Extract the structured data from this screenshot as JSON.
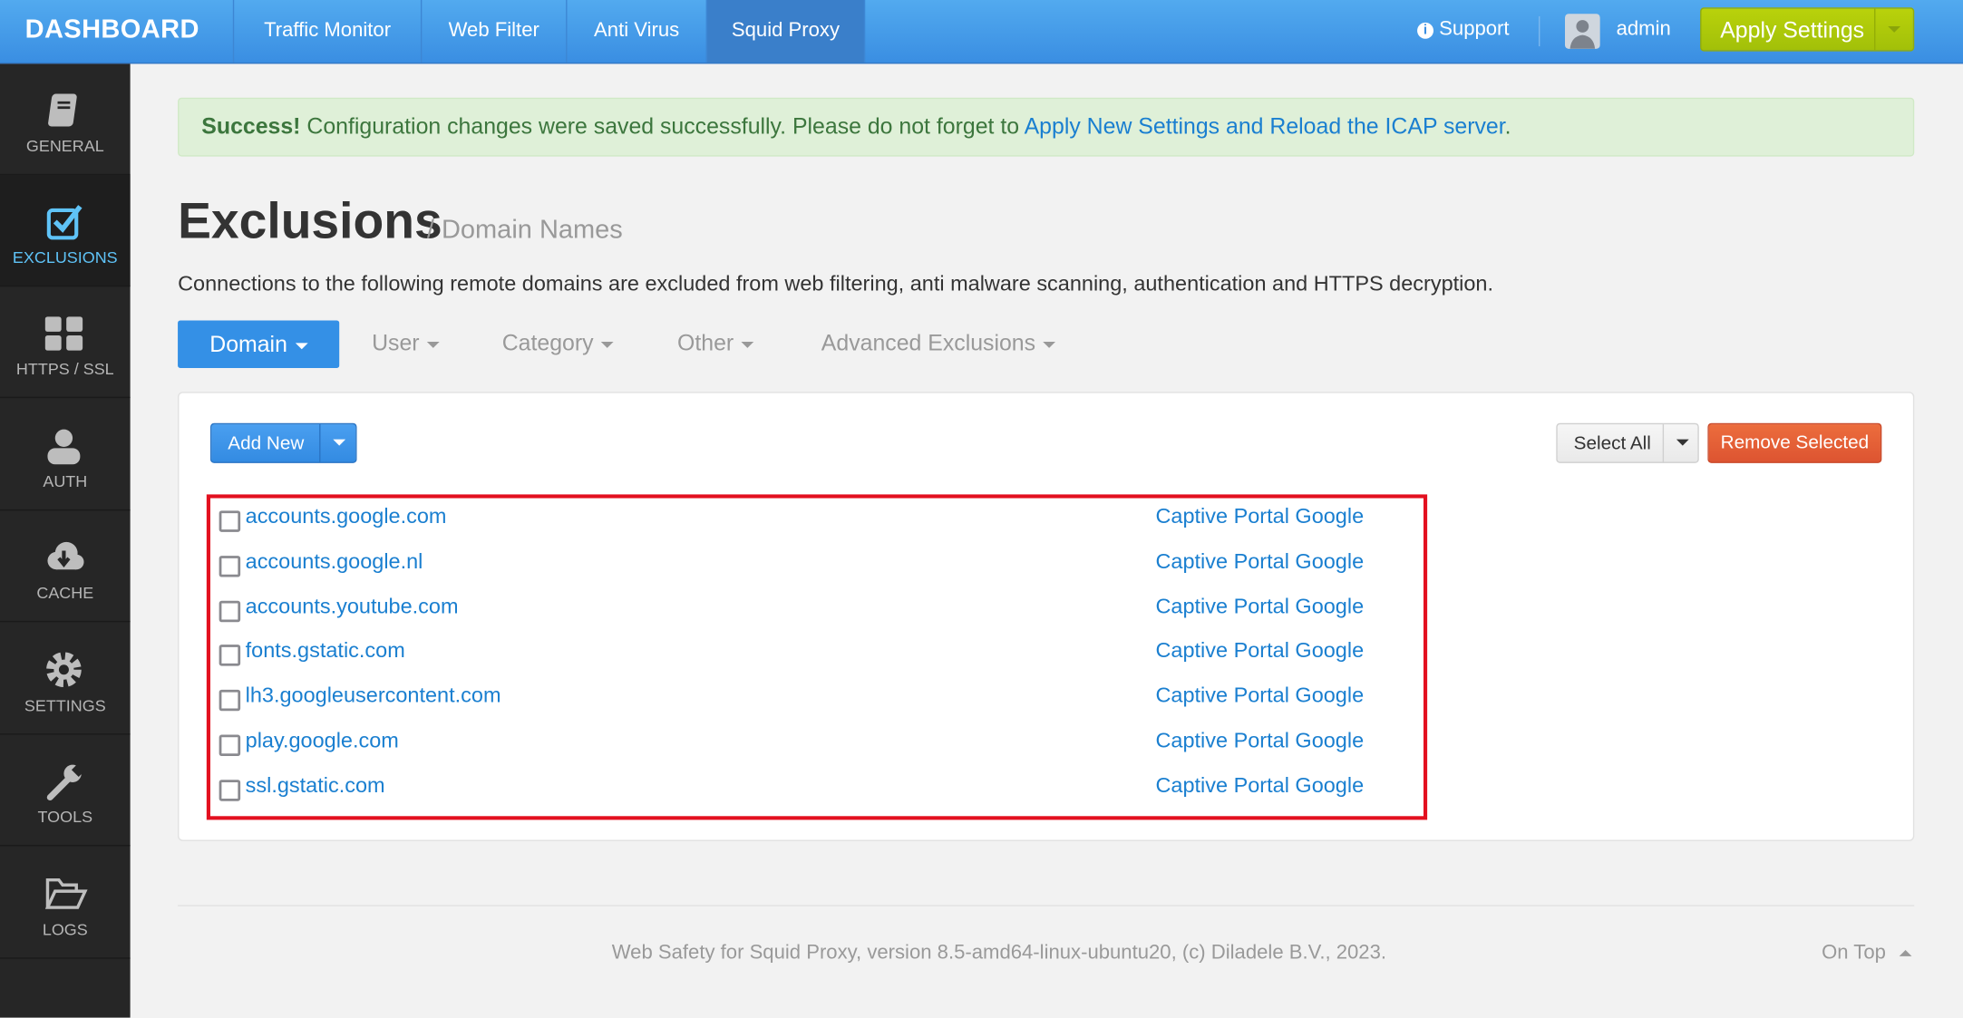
{
  "header": {
    "brand": "DASHBOARD",
    "nav": [
      "Traffic Monitor",
      "Web Filter",
      "Anti Virus",
      "Squid Proxy"
    ],
    "active_nav": "Squid Proxy",
    "support": "Support",
    "user": "admin",
    "apply": "Apply Settings"
  },
  "sidebar": {
    "items": [
      "GENERAL",
      "EXCLUSIONS",
      "HTTPS / SSL",
      "AUTH",
      "CACHE",
      "SETTINGS",
      "TOOLS",
      "LOGS"
    ],
    "active": "EXCLUSIONS"
  },
  "alert": {
    "strong": "Success!",
    "text": " Configuration changes were saved successfully. Please do not forget to ",
    "link": "Apply New Settings and Reload the ICAP server",
    "end": "."
  },
  "page": {
    "title": "Exclusions",
    "subtitle": "/ Domain Names",
    "description": "Connections to the following remote domains are excluded from web filtering, anti malware scanning, authentication and HTTPS decryption."
  },
  "tabs": [
    "Domain",
    "User",
    "Category",
    "Other",
    "Advanced Exclusions"
  ],
  "toolbar": {
    "add_new": "Add New",
    "select_all": "Select All",
    "remove_selected": "Remove Selected"
  },
  "rows": [
    {
      "domain": "accounts.google.com",
      "comment": "Captive Portal Google"
    },
    {
      "domain": "accounts.google.nl",
      "comment": "Captive Portal Google"
    },
    {
      "domain": "accounts.youtube.com",
      "comment": "Captive Portal Google"
    },
    {
      "domain": "fonts.gstatic.com",
      "comment": "Captive Portal Google"
    },
    {
      "domain": "lh3.googleusercontent.com",
      "comment": "Captive Portal Google"
    },
    {
      "domain": "play.google.com",
      "comment": "Captive Portal Google"
    },
    {
      "domain": "ssl.gstatic.com",
      "comment": "Captive Portal Google"
    }
  ],
  "footer": {
    "text": "Web Safety for Squid Proxy, version 8.5-amd64-linux-ubuntu20, (c) Diladele B.V., 2023.",
    "on_top": "On Top"
  }
}
